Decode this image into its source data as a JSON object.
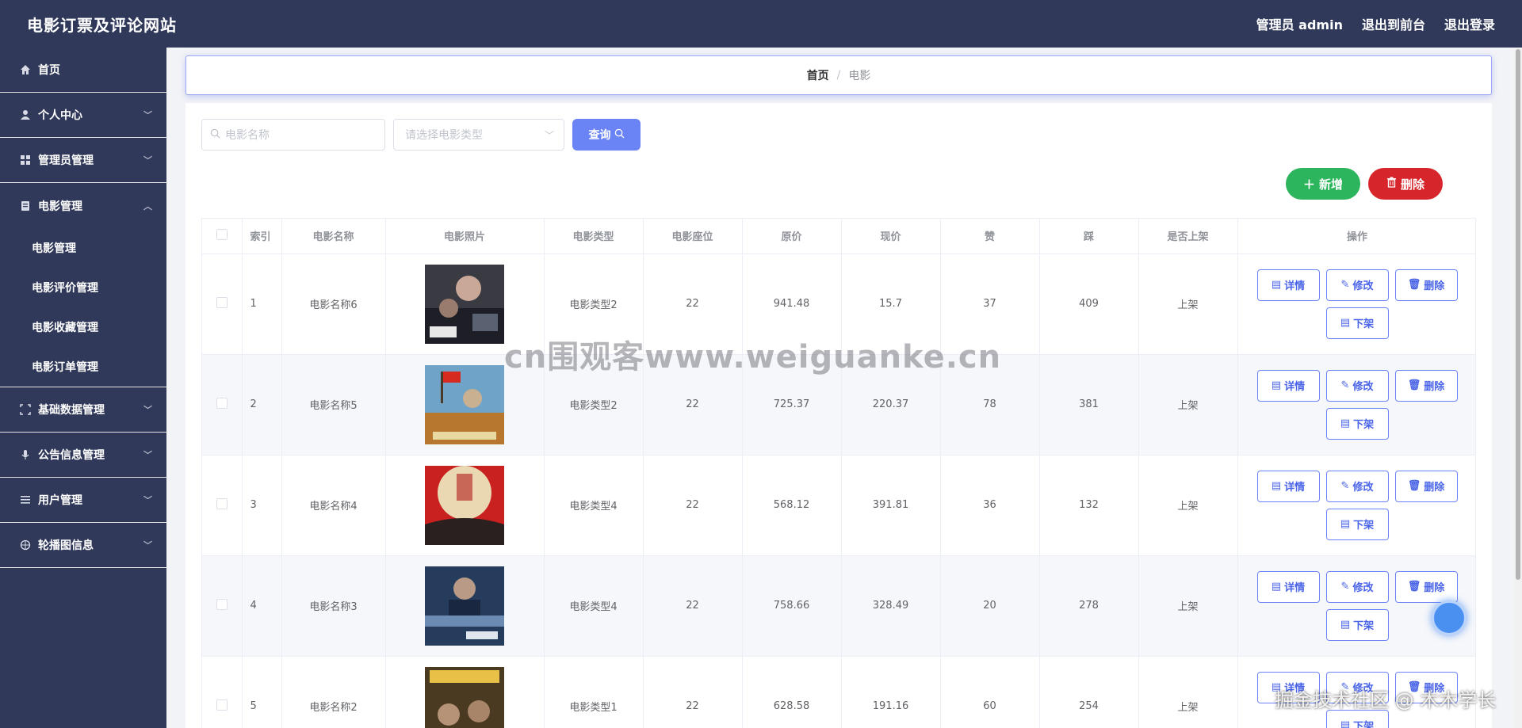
{
  "header": {
    "site_title": "电影订票及评论网站",
    "admin_label": "管理员 admin",
    "front_link": "退出到前台",
    "logout_link": "退出登录"
  },
  "sidebar": {
    "home": "首页",
    "personal": "个人中心",
    "admin_mgmt": "管理员管理",
    "movie_mgmt": "电影管理",
    "sub_items": [
      "电影管理",
      "电影评价管理",
      "电影收藏管理",
      "电影订单管理"
    ],
    "basic_data": "基础数据管理",
    "notice": "公告信息管理",
    "users": "用户管理",
    "carousel": "轮播图信息"
  },
  "breadcrumb": {
    "home": "首页",
    "separator": "/",
    "current": "电影"
  },
  "search": {
    "name_placeholder": "电影名称",
    "type_placeholder": "请选择电影类型",
    "query_label": "查询"
  },
  "actions": {
    "add_label": "新增",
    "delete_label": "删除"
  },
  "table": {
    "headers": [
      "索引",
      "电影名称",
      "电影照片",
      "电影类型",
      "电影座位",
      "原价",
      "现价",
      "赞",
      "踩",
      "是否上架",
      "操作"
    ],
    "op_labels": {
      "detail": "详情",
      "edit": "修改",
      "delete": "删除",
      "offline": "下架"
    },
    "rows": [
      {
        "index": "1",
        "name": "电影名称6",
        "type": "电影类型2",
        "seats": "22",
        "orig": "941.48",
        "now": "15.7",
        "like": "37",
        "dislike": "409",
        "status": "上架"
      },
      {
        "index": "2",
        "name": "电影名称5",
        "type": "电影类型2",
        "seats": "22",
        "orig": "725.37",
        "now": "220.37",
        "like": "78",
        "dislike": "381",
        "status": "上架"
      },
      {
        "index": "3",
        "name": "电影名称4",
        "type": "电影类型4",
        "seats": "22",
        "orig": "568.12",
        "now": "391.81",
        "like": "36",
        "dislike": "132",
        "status": "上架"
      },
      {
        "index": "4",
        "name": "电影名称3",
        "type": "电影类型4",
        "seats": "22",
        "orig": "758.66",
        "now": "328.49",
        "like": "20",
        "dislike": "278",
        "status": "上架"
      },
      {
        "index": "5",
        "name": "电影名称2",
        "type": "电影类型1",
        "seats": "22",
        "orig": "628.58",
        "now": "191.16",
        "like": "60",
        "dislike": "254",
        "status": "上架"
      }
    ]
  },
  "watermark": {
    "main": "cn围观客www.weiguanke.cn",
    "corner": "掘金技术社区 @ 木木学长"
  }
}
